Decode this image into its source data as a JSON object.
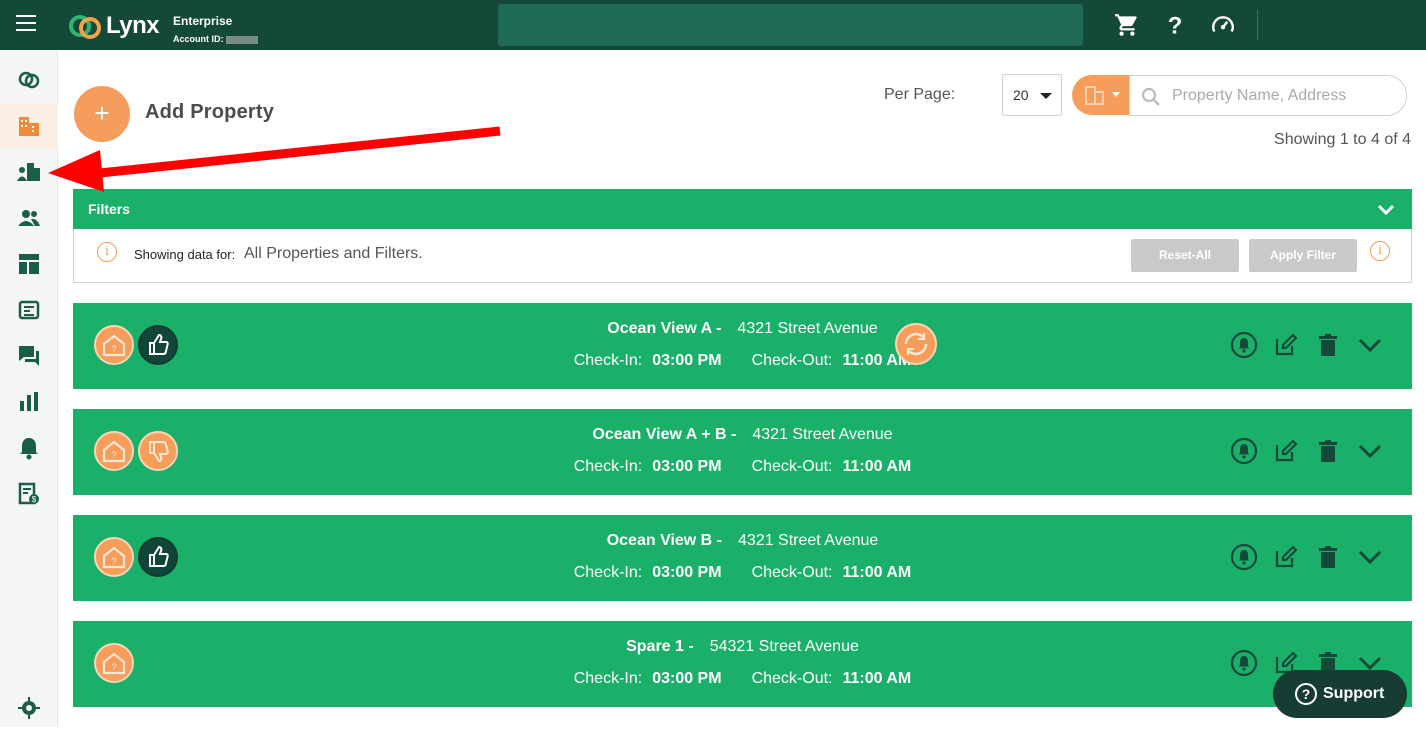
{
  "header": {
    "brand": "Lynx",
    "tier": "Enterprise",
    "account_label": "Account ID:"
  },
  "sidebar": {
    "items": [
      "logo-icon",
      "properties-icon",
      "property-groups-icon",
      "users-icon",
      "dashboard-icon",
      "integrations-icon",
      "messages-icon",
      "reports-icon",
      "notifications-icon",
      "billing-icon",
      "settings-icon"
    ]
  },
  "toolbar": {
    "add_label": "Add Property",
    "add_symbol": "+",
    "per_page_label": "Per Page:",
    "per_page_value": "20",
    "search_placeholder": "Property Name, Address",
    "showing": "Showing 1 to 4 of 4"
  },
  "filters": {
    "title": "Filters",
    "showing_label": "Showing data for:",
    "showing_value": "All Properties and Filters.",
    "reset_label": "Reset-All",
    "apply_label": "Apply Filter"
  },
  "properties": [
    {
      "name": "Ocean View A -",
      "address": "4321 Street Avenue",
      "checkin_label": "Check-In:",
      "checkin": "03:00 PM",
      "checkout_label": "Check-Out:",
      "checkout": "11:00 AM",
      "rating": "thumbs-up",
      "synced": true
    },
    {
      "name": "Ocean View A + B -",
      "address": "4321 Street Avenue",
      "checkin_label": "Check-In:",
      "checkin": "03:00 PM",
      "checkout_label": "Check-Out:",
      "checkout": "11:00 AM",
      "rating": "thumbs-down",
      "synced": false
    },
    {
      "name": "Ocean View B -",
      "address": "4321 Street Avenue",
      "checkin_label": "Check-In:",
      "checkin": "03:00 PM",
      "checkout_label": "Check-Out:",
      "checkout": "11:00 AM",
      "rating": "thumbs-up",
      "synced": false
    },
    {
      "name": "Spare 1 -",
      "address": "54321 Street Avenue",
      "checkin_label": "Check-In:",
      "checkin": "03:00 PM",
      "checkout_label": "Check-Out:",
      "checkout": "11:00 AM",
      "rating": "none",
      "synced": false
    }
  ],
  "support": {
    "label": "Support",
    "icon": "?"
  },
  "colors": {
    "header_bg": "#14493a",
    "accent_green": "#1ab06a",
    "accent_orange": "#f79d5c",
    "annotation_red": "#ff0000"
  }
}
